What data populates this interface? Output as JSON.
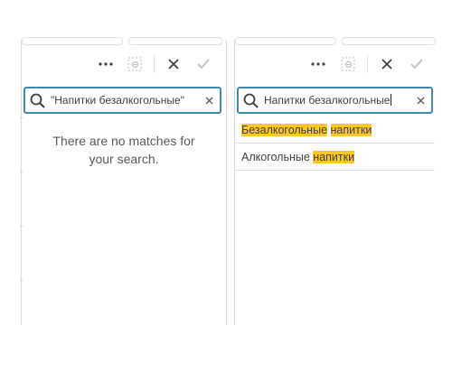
{
  "colors": {
    "accent": "#3f8ab3",
    "highlight": "#ffc72a",
    "icon": "#595959",
    "disabled_icon": "#bfbfbf"
  },
  "left_panel": {
    "search": {
      "value": "\"Напитки безалкогольные\""
    },
    "no_results": {
      "line1": "There are no matches for",
      "line2": "your search."
    }
  },
  "right_panel": {
    "search": {
      "value": "Напитки безалкогольные"
    },
    "results": [
      {
        "part1": "Безалкогольные",
        "sep": " ",
        "part2": "напитки",
        "part1_highlight": true,
        "part2_highlight": true
      },
      {
        "part1": "Алкогольные",
        "sep": " ",
        "part2": "напитки",
        "part1_highlight": false,
        "part2_highlight": true
      }
    ]
  },
  "toolbar": {
    "more_icon": "more-horizontal-icon",
    "lock_icon": "selection-lock-icon",
    "cancel_icon": "close-icon",
    "confirm_icon": "check-icon"
  }
}
